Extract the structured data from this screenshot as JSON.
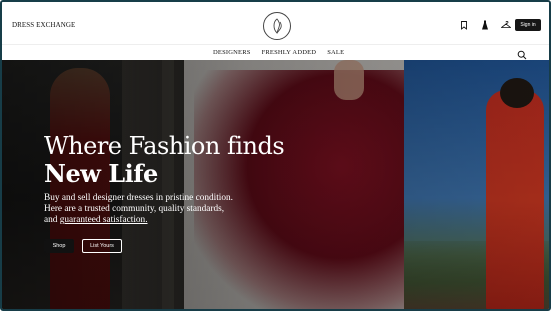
{
  "header": {
    "brand": "DRESS EXCHANGE",
    "sign_in_label": "Sign in",
    "icons": [
      "bookmark-icon",
      "dress-icon",
      "hanger-icon"
    ]
  },
  "nav": {
    "items": [
      {
        "label": "DESIGNERS"
      },
      {
        "label": "FRESHLY ADDED"
      },
      {
        "label": "SALE"
      }
    ],
    "search_icon": "search-icon"
  },
  "hero": {
    "title_line1": "Where Fashion finds",
    "title_line2": "New Life",
    "subtitle_line1": "Buy and sell designer dresses in pristine condition.",
    "subtitle_line2": "Here are a trusted community, quality standards,",
    "subtitle_line3_prefix": "and ",
    "subtitle_line3_link": "guaranteed satisfaction.",
    "shop_label": "Shop",
    "list_label": "List Yours"
  },
  "colors": {
    "accent_dark": "#161616",
    "frame": "#173d48"
  }
}
